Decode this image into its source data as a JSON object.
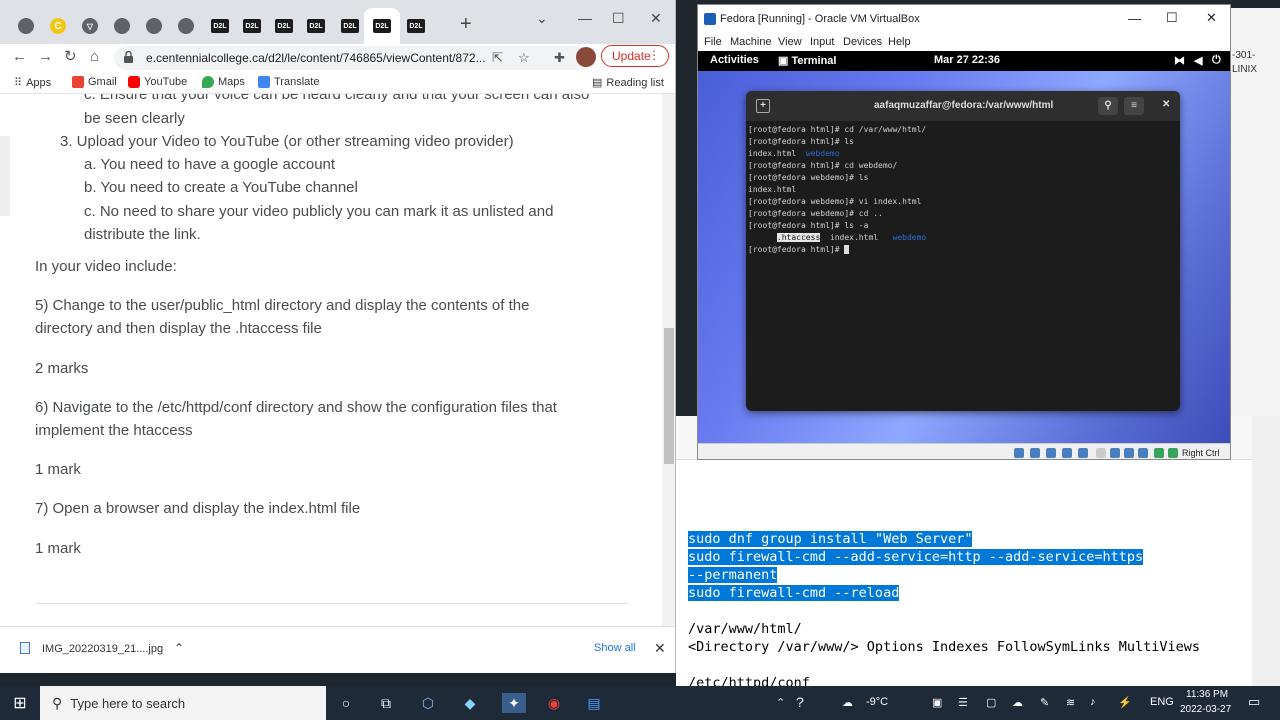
{
  "browser": {
    "url": "e.centennialcollege.ca/d2l/le/content/746865/viewContent/872...",
    "update_label": "Update",
    "tabs": [
      "",
      "",
      "",
      "",
      "",
      "D2L",
      "D2L",
      "D2L",
      "D2L",
      "D2L",
      "D2L",
      "D2L"
    ],
    "bookmarks": [
      "Apps",
      "Gmail",
      "YouTube",
      "Maps",
      "Translate"
    ],
    "reading_list": "Reading list"
  },
  "content": {
    "partial_line": "c. Ensure that your voice can be heard clearly and that your screen can also",
    "line_seen": "be seen clearly",
    "item3": "3. Upload your Video to YouTube (or other streaming video provider)",
    "item3a": "a. You need to have a google account",
    "item3b": "b. You need to create a YouTube channel",
    "item3c1": "c. No need to share your video publicly you can mark it as unlisted and",
    "item3c2": "distribute the link.",
    "include": "In your video include:",
    "q5a": "5) Change to the user/public_html directory and display the contents of the",
    "q5b": "directory and then display the .htaccess file",
    "m5": "2 marks",
    "q6a": "6) Navigate to the /etc/httpd/conf directory and show the configuration files that",
    "q6b": "implement the htaccess",
    "m6": "1 mark",
    "q7": "7) Open a browser and display the index.html file",
    "m7": "1 mark"
  },
  "downloads": {
    "file": "IMG_20220319_21....jpg",
    "show_all": "Show all"
  },
  "vbox": {
    "title": "Fedora [Running] - Oracle VM VirtualBox",
    "menu": [
      "File",
      "Machine",
      "View",
      "Input",
      "Devices",
      "Help"
    ],
    "activities": "Activities",
    "terminal_app": "Terminal",
    "clock": "Mar 27  22:36",
    "terminal_title": "aafaqmuzaffar@fedora:/var/www/html",
    "right_ctrl": "Right Ctrl",
    "terminal_lines": [
      "[root@fedora html]# cd /var/www/html/",
      "[root@fedora html]# ls",
      "index.html",
      "[root@fedora html]# cd webdemo/",
      "[root@fedora webdemo]# ls",
      "index.html",
      "[root@fedora webdemo]# vi index.html",
      "[root@fedora webdemo]# cd ..",
      "[root@fedora html]# ls -a",
      "",
      "[root@fedora html]# "
    ],
    "blue_webdemo": "webdemo",
    "htaccess": ".htaccess",
    "index_html": "index.html"
  },
  "desktop_strip": [
    "-301-",
    "LINIX"
  ],
  "notes": {
    "lines": [
      "sudo dnf group install \"Web Server\"",
      "sudo firewall-cmd --add-service=http --add-service=https",
      "--permanent",
      "sudo firewall-cmd --reload",
      "",
      "/var/www/html/",
      "<Directory /var/www/> Options Indexes FollowSymLinks MultiViews",
      "",
      "/etc/httpd/conf"
    ]
  },
  "taskbar": {
    "search_placeholder": "Type here to search",
    "temp": "-9°C",
    "lang": "ENG",
    "time": "11:36 PM",
    "date": "2022-03-27"
  }
}
